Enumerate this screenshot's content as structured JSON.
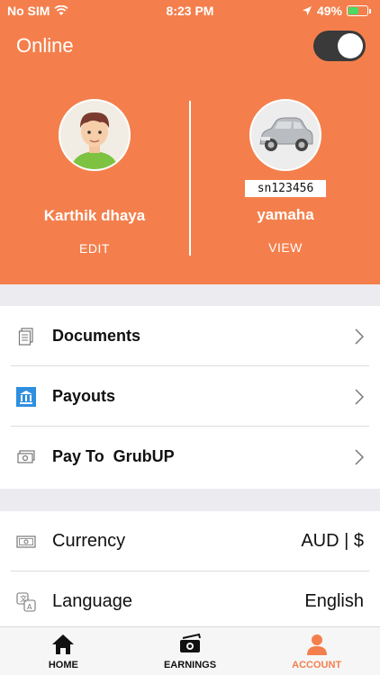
{
  "status_bar": {
    "carrier": "No SIM",
    "time": "8:23 PM",
    "battery": "49%",
    "battery_level": 0.49
  },
  "header": {
    "online_label": "Online",
    "online_toggle_on": true,
    "brand_color": "#f47f4c"
  },
  "driver": {
    "name": "Karthik dhaya",
    "action": "EDIT"
  },
  "vehicle": {
    "plate": "sn123456",
    "name": "yamaha",
    "action": "VIEW"
  },
  "menu": [
    {
      "label": "Documents",
      "icon": "document-icon"
    },
    {
      "label": "Payouts",
      "icon": "bank-icon"
    },
    {
      "label": "Pay To  GrubUP",
      "icon": "money-icon"
    }
  ],
  "settings": [
    {
      "label": "Currency",
      "value": "AUD | $",
      "icon": "cash-icon"
    },
    {
      "label": "Language",
      "value": "English",
      "icon": "translate-icon"
    }
  ],
  "tabs": [
    {
      "label": "HOME",
      "icon": "home-icon",
      "active": false
    },
    {
      "label": "EARNINGS",
      "icon": "earnings-icon",
      "active": false
    },
    {
      "label": "ACCOUNT",
      "icon": "account-icon",
      "active": true
    }
  ]
}
